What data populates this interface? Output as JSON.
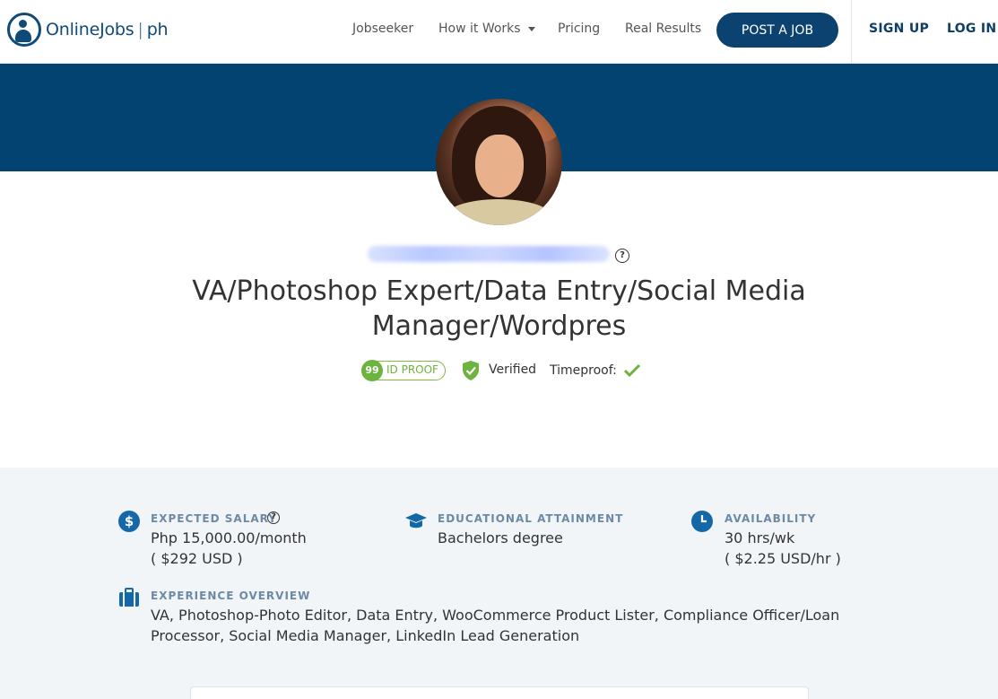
{
  "brand": {
    "name": "OnlineJobs",
    "suffix": "ph"
  },
  "nav": {
    "jobseeker": "Jobseeker",
    "how_it_works": "How it Works",
    "pricing": "Pricing",
    "real_results": "Real Results",
    "post_job": "POST A JOB",
    "sign_up": "SIGN UP",
    "log_in": "LOG IN"
  },
  "profile": {
    "title": "VA/Photoshop Expert/Data Entry/Social Media Manager/Wordpres",
    "id_proof_score": "99",
    "id_proof_label": "ID PROOF",
    "verified_label": "Verified",
    "timeproof_label": "Timeproof:",
    "help": "?"
  },
  "details": {
    "salary": {
      "label": "EXPECTED SALARY",
      "value": "Php 15,000.00/month",
      "usd": "( $292 USD )",
      "icon": "$"
    },
    "education": {
      "label": "EDUCATIONAL ATTAINMENT",
      "value": "Bachelors degree"
    },
    "availability": {
      "label": "AVAILABILITY",
      "value": "30 hrs/wk",
      "rate": "( $2.25 USD/hr )"
    },
    "experience": {
      "label": "EXPERIENCE OVERVIEW",
      "line1": "VA, Photoshop-Photo Editor, Data Entry, WooCommerce Product Lister, Compliance Officer/Loan",
      "line2": "Processor, Social Media Manager, LinkedIn Lead Generation"
    }
  },
  "colors": {
    "brand_blue": "#034371",
    "button_blue": "#0c4270",
    "icon_blue": "#1568a8",
    "green": "#6db33f"
  }
}
